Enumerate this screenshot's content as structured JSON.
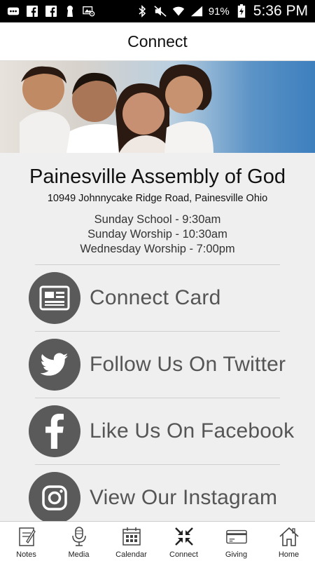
{
  "status_bar": {
    "battery_percent": "91%",
    "time": "5:36 PM",
    "left_icons": [
      "chat-icon",
      "facebook-icon",
      "facebook-icon",
      "keyhole-icon",
      "image-settings-icon"
    ],
    "right_icons": [
      "bluetooth-icon",
      "mute-icon",
      "wifi-icon",
      "signal-icon",
      "battery-charging-icon"
    ]
  },
  "header": {
    "title": "Connect"
  },
  "church": {
    "name": "Painesville Assembly of God",
    "address": "10949 Johnnycake Ridge Road, Painesville Ohio",
    "schedule": [
      "Sunday School - 9:30am",
      "Sunday Worship - 10:30am",
      "Wednesday Worship - 7:00pm"
    ]
  },
  "links": [
    {
      "label": "Connect Card",
      "icon": "card-icon"
    },
    {
      "label": "Follow Us On Twitter",
      "icon": "twitter-icon"
    },
    {
      "label": "Like Us On Facebook",
      "icon": "facebook-icon"
    },
    {
      "label": "View Our Instagram",
      "icon": "instagram-icon"
    }
  ],
  "tabs": [
    {
      "label": "Notes",
      "icon": "notes-icon"
    },
    {
      "label": "Media",
      "icon": "microphone-icon"
    },
    {
      "label": "Calendar",
      "icon": "calendar-icon"
    },
    {
      "label": "Connect",
      "icon": "connect-arrows-icon"
    },
    {
      "label": "Giving",
      "icon": "credit-card-icon"
    },
    {
      "label": "Home",
      "icon": "home-icon"
    }
  ],
  "colors": {
    "icon_circle": "#5a5a5a",
    "link_text": "#555555",
    "background": "#efefef",
    "hero_blue": "#3d7fbe"
  }
}
